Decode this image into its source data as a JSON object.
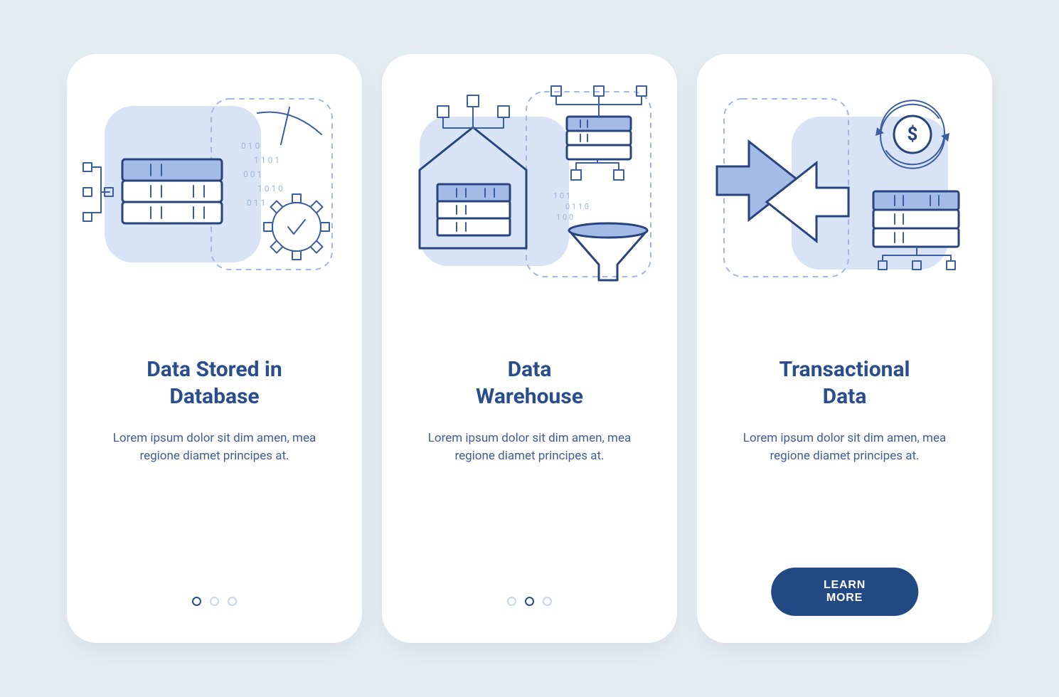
{
  "cards": [
    {
      "title_line1": "Data Stored in",
      "title_line2": "Database",
      "body": "Lorem ipsum dolor sit dim amen, mea regione diamet principes at.",
      "active_dot": 0,
      "show_pager": true,
      "show_cta": false
    },
    {
      "title_line1": "Data",
      "title_line2": "Warehouse",
      "body": "Lorem ipsum dolor sit dim amen, mea regione diamet principes at.",
      "active_dot": 1,
      "show_pager": true,
      "show_cta": false
    },
    {
      "title_line1": "Transactional",
      "title_line2": "Data",
      "body": "Lorem ipsum dolor sit dim amen, mea regione diamet principes at.",
      "active_dot": 2,
      "show_pager": false,
      "show_cta": true,
      "cta_label": "LEARN MORE"
    }
  ],
  "colors": {
    "bg": "#e4edf0",
    "card": "#ffffff",
    "primary": "#274c8a",
    "text_muted": "#3f5e95",
    "light_stroke": "#a0b8e0",
    "tint": "#d8e3f6",
    "mid_fill": "#a3bbe6"
  }
}
